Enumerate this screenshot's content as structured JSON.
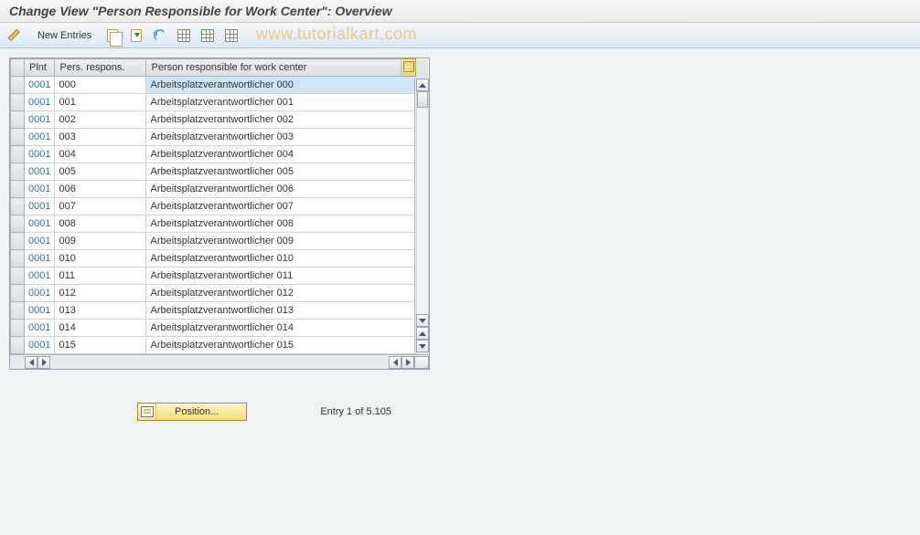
{
  "title": "Change View \"Person Responsible for Work Center\": Overview",
  "toolbar": {
    "new_entries": "New Entries"
  },
  "watermark": "www.tutorialkart.com",
  "columns": {
    "plnt": "Plnt",
    "pers": "Pers. respons.",
    "desc": "Person responsible for work center"
  },
  "rows": [
    {
      "plnt": "0001",
      "pers": "000",
      "desc": "Arbeitsplatzverantwortlicher 000",
      "selected": true
    },
    {
      "plnt": "0001",
      "pers": "001",
      "desc": "Arbeitsplatzverantwortlicher 001"
    },
    {
      "plnt": "0001",
      "pers": "002",
      "desc": "Arbeitsplatzverantwortlicher 002"
    },
    {
      "plnt": "0001",
      "pers": "003",
      "desc": "Arbeitsplatzverantwortlicher 003"
    },
    {
      "plnt": "0001",
      "pers": "004",
      "desc": "Arbeitsplatzverantwortlicher 004"
    },
    {
      "plnt": "0001",
      "pers": "005",
      "desc": "Arbeitsplatzverantwortlicher 005"
    },
    {
      "plnt": "0001",
      "pers": "006",
      "desc": "Arbeitsplatzverantwortlicher 006"
    },
    {
      "plnt": "0001",
      "pers": "007",
      "desc": "Arbeitsplatzverantwortlicher 007"
    },
    {
      "plnt": "0001",
      "pers": "008",
      "desc": "Arbeitsplatzverantwortlicher 008"
    },
    {
      "plnt": "0001",
      "pers": "009",
      "desc": "Arbeitsplatzverantwortlicher 009"
    },
    {
      "plnt": "0001",
      "pers": "010",
      "desc": "Arbeitsplatzverantwortlicher 010"
    },
    {
      "plnt": "0001",
      "pers": "011",
      "desc": "Arbeitsplatzverantwortlicher 011"
    },
    {
      "plnt": "0001",
      "pers": "012",
      "desc": "Arbeitsplatzverantwortlicher 012"
    },
    {
      "plnt": "0001",
      "pers": "013",
      "desc": "Arbeitsplatzverantwortlicher 013"
    },
    {
      "plnt": "0001",
      "pers": "014",
      "desc": "Arbeitsplatzverantwortlicher 014"
    },
    {
      "plnt": "0001",
      "pers": "015",
      "desc": "Arbeitsplatzverantwortlicher 015"
    }
  ],
  "footer": {
    "position_label": "Position...",
    "entry_text": "Entry 1 of 5.105"
  }
}
